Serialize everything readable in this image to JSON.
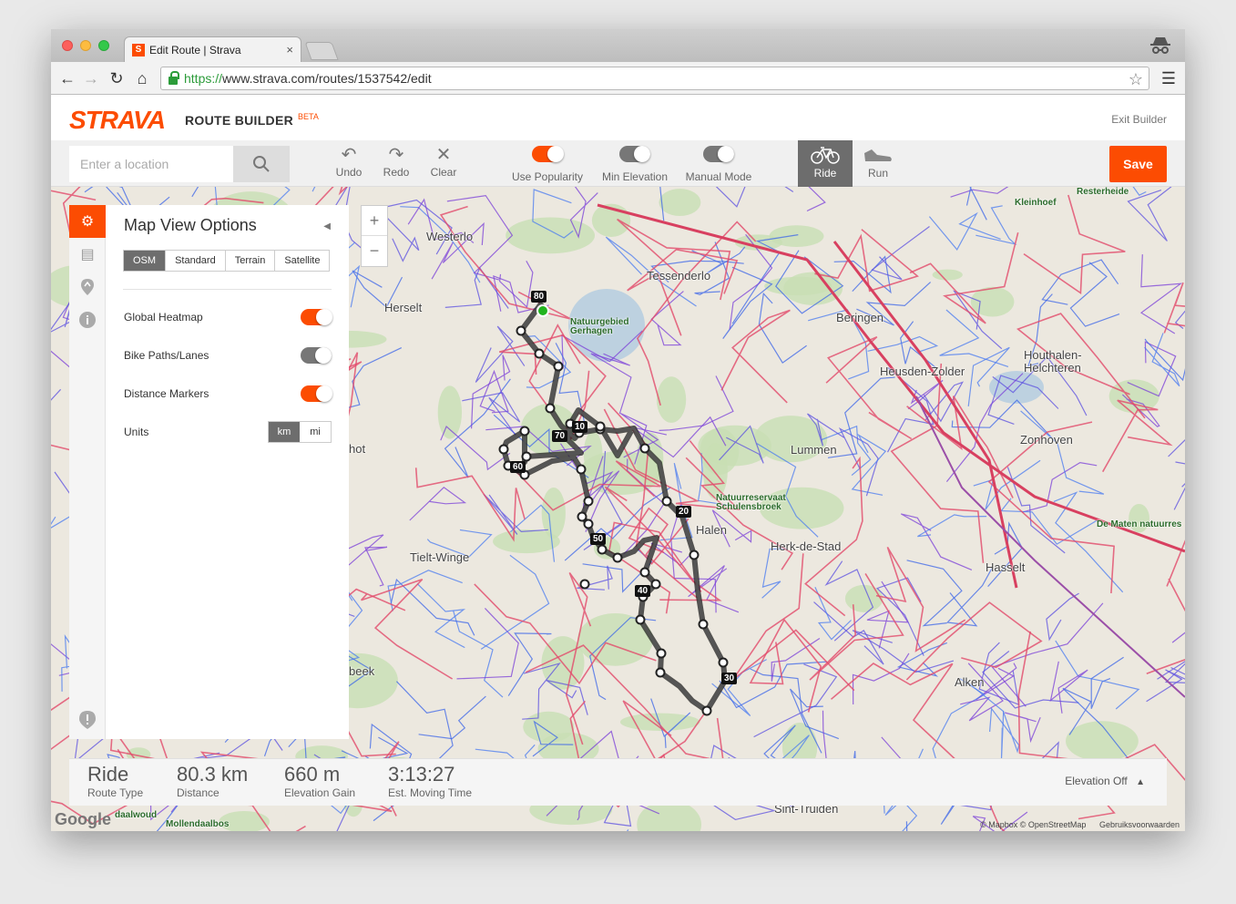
{
  "browser": {
    "tab_title": "Edit Route | Strava",
    "favicon_letter": "S",
    "url_secure": "https://",
    "url_rest": "www.strava.com/routes/1537542/edit"
  },
  "header": {
    "logo": "STRAVA",
    "title": "ROUTE BUILDER",
    "badge": "BETA",
    "exit_label": "Exit Builder"
  },
  "toolbar": {
    "search_placeholder": "Enter a location",
    "undo": "Undo",
    "redo": "Redo",
    "clear": "Clear",
    "use_popularity": "Use Popularity",
    "min_elevation": "Min Elevation",
    "manual_mode": "Manual Mode",
    "ride": "Ride",
    "run": "Run",
    "save": "Save",
    "use_popularity_on": true,
    "min_elevation_on": false,
    "manual_mode_on": false,
    "active_sport": "Ride"
  },
  "options_panel": {
    "title": "Map View Options",
    "map_types": [
      "OSM",
      "Standard",
      "Terrain",
      "Satellite"
    ],
    "selected_map_type": "OSM",
    "global_heatmap": "Global Heatmap",
    "bike_paths": "Bike Paths/Lanes",
    "distance_markers": "Distance Markers",
    "units": "Units",
    "unit_km": "km",
    "unit_mi": "mi",
    "selected_unit": "km",
    "global_heatmap_on": true,
    "bike_paths_on": false,
    "distance_markers_on": true
  },
  "zoom": {
    "in": "+",
    "out": "−"
  },
  "stats": {
    "route_type_value": "Ride",
    "route_type_label": "Route Type",
    "distance_value": "80.3 km",
    "distance_label": "Distance",
    "elevation_value": "660 m",
    "elevation_label": "Elevation Gain",
    "time_value": "3:13:27",
    "time_label": "Est. Moving Time",
    "elevation_toggle": "Elevation Off"
  },
  "map": {
    "places": [
      "Westerlo",
      "Tessenderlo",
      "Herselt",
      "Natuurgebied Gerhagen",
      "Beringen",
      "Heusden-Zolder",
      "Houthalen-Helchteren",
      "Zonhoven",
      "Lummen",
      "Natuurreservaat Schulensbroek",
      "Halen",
      "Herk-de-Stad",
      "Hasselt",
      "Tielt-Winge",
      "Alken",
      "Sint-Truiden",
      "Kleinhoef",
      "Resterheide",
      "De Maten natuurres",
      "Mollendaalbos",
      "daalwoud",
      "beek",
      "hot"
    ],
    "distance_markers": [
      "80",
      "70",
      "10",
      "60",
      "20",
      "50",
      "40",
      "30"
    ],
    "attribution": "© Mapbox © OpenStreetMap",
    "terms": "Gebruiksvoorwaarden",
    "google": "Google"
  }
}
